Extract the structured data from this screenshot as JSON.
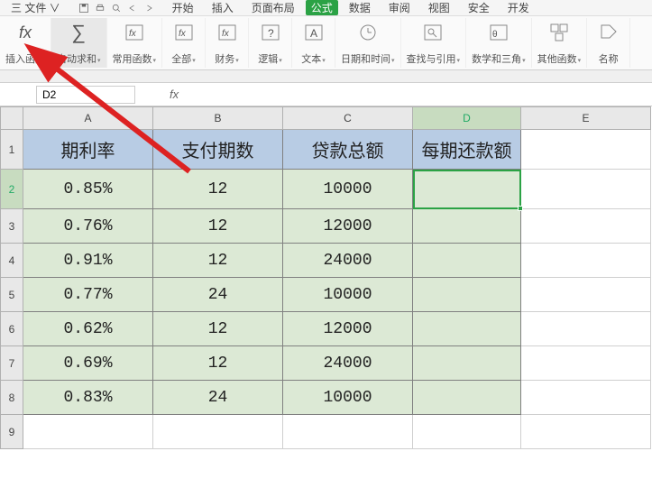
{
  "topMenu": {
    "file": "三 文件 ∨",
    "items": [
      "开始",
      "插入",
      "页面布局",
      "公式",
      "数据",
      "审阅",
      "视图",
      "安全",
      "开发"
    ],
    "activeIndex": 3
  },
  "ribbon": [
    {
      "id": "insert-fn",
      "label": "插入函数",
      "icon": "fx"
    },
    {
      "id": "autosum",
      "label": "自动求和",
      "icon": "sigma",
      "dd": true,
      "highlight": true
    },
    {
      "id": "recent",
      "label": "常用函数",
      "icon": "fxstar",
      "dd": true
    },
    {
      "id": "all",
      "label": "全部",
      "icon": "fxbox",
      "dd": true
    },
    {
      "id": "financial",
      "label": "财务",
      "icon": "fxbox",
      "dd": true
    },
    {
      "id": "logical",
      "label": "逻辑",
      "icon": "qmark",
      "dd": true
    },
    {
      "id": "text",
      "label": "文本",
      "icon": "abox",
      "dd": true
    },
    {
      "id": "datetime",
      "label": "日期和时间",
      "icon": "clock",
      "dd": true
    },
    {
      "id": "lookup",
      "label": "查找与引用",
      "icon": "lookup",
      "dd": true
    },
    {
      "id": "math",
      "label": "数学和三角",
      "icon": "math",
      "dd": true
    },
    {
      "id": "more",
      "label": "其他函数",
      "icon": "boxes",
      "dd": true
    },
    {
      "id": "names",
      "label": "名称",
      "icon": "tag"
    }
  ],
  "nameBox": "D2",
  "columns": [
    "A",
    "B",
    "C",
    "D",
    "E"
  ],
  "selectedCol": "D",
  "selectedRow": 2,
  "headers": {
    "A": "期利率",
    "B": "支付期数",
    "C": "贷款总额",
    "D": "每期还款额"
  },
  "rows": [
    {
      "A": "0.85%",
      "B": "12",
      "C": "10000",
      "D": ""
    },
    {
      "A": "0.76%",
      "B": "12",
      "C": "12000",
      "D": ""
    },
    {
      "A": "0.91%",
      "B": "12",
      "C": "24000",
      "D": ""
    },
    {
      "A": "0.77%",
      "B": "24",
      "C": "10000",
      "D": ""
    },
    {
      "A": "0.62%",
      "B": "12",
      "C": "12000",
      "D": ""
    },
    {
      "A": "0.69%",
      "B": "12",
      "C": "24000",
      "D": ""
    },
    {
      "A": "0.83%",
      "B": "24",
      "C": "10000",
      "D": ""
    }
  ]
}
